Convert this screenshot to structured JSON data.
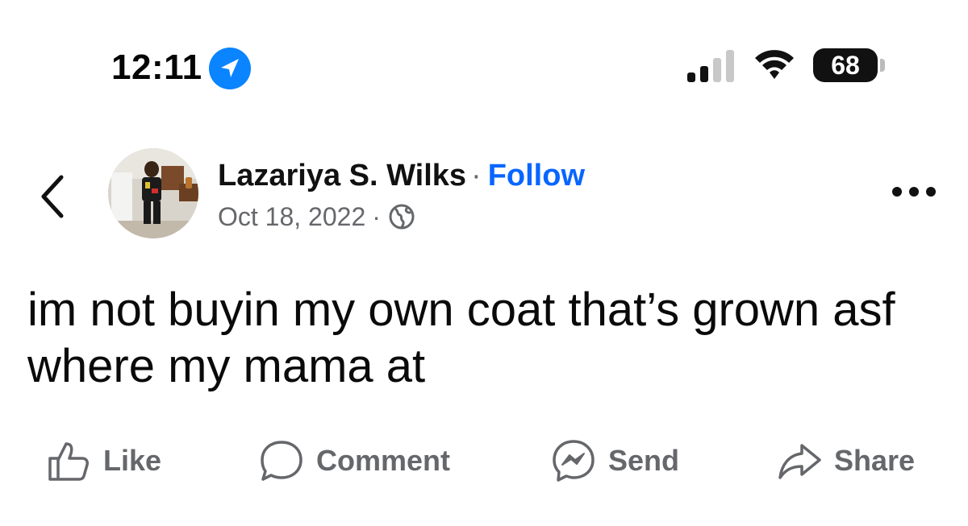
{
  "status_bar": {
    "time": "12:11",
    "battery": "68",
    "icons": [
      "location-arrow-icon",
      "cellular-signal-icon",
      "wifi-icon",
      "battery-icon"
    ]
  },
  "header": {
    "author_name": "Lazariya S. Wilks",
    "separator": "·",
    "follow_label": "Follow",
    "date": "Oct 18, 2022",
    "audience_icon": "globe-icon"
  },
  "post": {
    "text": "im not buyin my own coat that’s grown asf where my mama at"
  },
  "actions": [
    {
      "label": "Like",
      "icon": "thumbs-up-icon"
    },
    {
      "label": "Comment",
      "icon": "comment-bubble-icon"
    },
    {
      "label": "Send",
      "icon": "messenger-icon"
    },
    {
      "label": "Share",
      "icon": "share-arrow-icon"
    }
  ],
  "colors": {
    "accent": "#0866ff",
    "secondary_text": "#65676b",
    "primary_text": "#050505",
    "background": "#ffffff"
  }
}
